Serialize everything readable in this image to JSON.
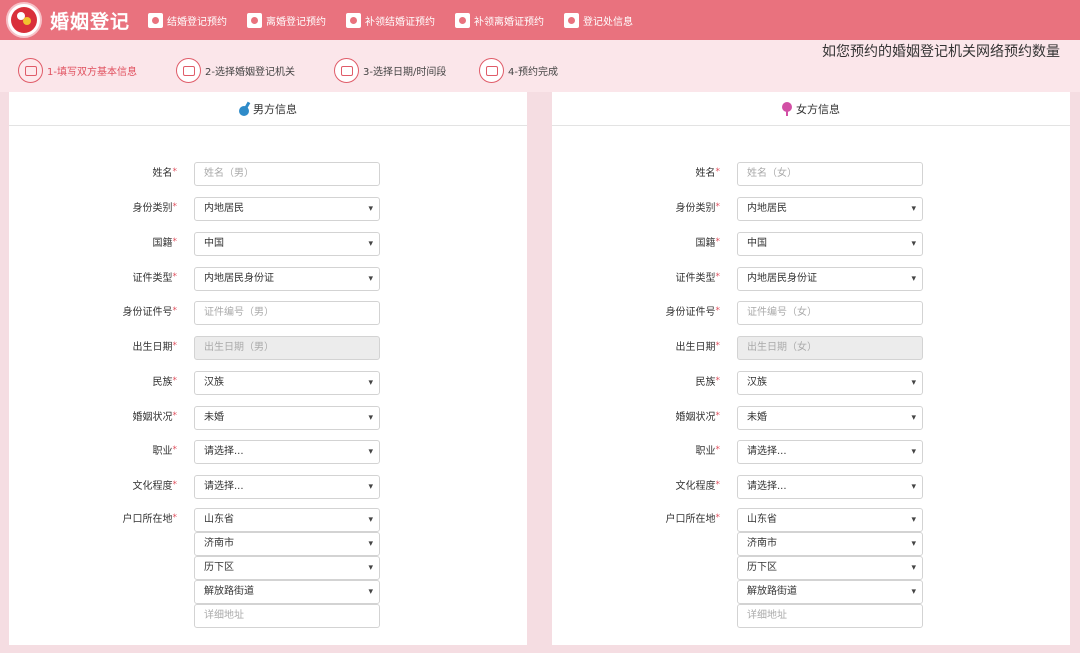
{
  "header": {
    "brand": "婚姻登记",
    "nav": [
      {
        "label": "结婚登记预约",
        "icon": "ring-certificate-icon"
      },
      {
        "label": "离婚登记预约",
        "icon": "certificate-icon"
      },
      {
        "label": "补领结婚证预约",
        "icon": "marriage-book-icon"
      },
      {
        "label": "补领离婚证预约",
        "icon": "divorce-book-icon"
      },
      {
        "label": "登记处信息",
        "icon": "office-icon"
      }
    ]
  },
  "notice": "如您预约的婚姻登记机关网络预约数量",
  "steps": [
    {
      "label": "1-填写双方基本信息",
      "icon": "id-card-icon"
    },
    {
      "label": "2-选择婚姻登记机关",
      "icon": "check-icon"
    },
    {
      "label": "3-选择日期/时间段",
      "icon": "calendar-check-icon"
    },
    {
      "label": "4-预约完成",
      "icon": "calendar-done-icon"
    }
  ],
  "colors": {
    "accent": "#e9727e",
    "required": "#e0505e"
  },
  "labels": {
    "name": "姓名",
    "id_category": "身份类别",
    "nationality": "国籍",
    "doc_type": "证件类型",
    "id_number": "身份证件号",
    "birth_date": "出生日期",
    "ethnicity": "民族",
    "marital_status": "婚姻状况",
    "occupation": "职业",
    "education": "文化程度",
    "household": "户口所在地"
  },
  "male": {
    "title": "男方信息",
    "name_placeholder": "姓名（男）",
    "id_category": "内地居民",
    "nationality": "中国",
    "doc_type": "内地居民身份证",
    "id_placeholder": "证件编号（男）",
    "birth_placeholder": "出生日期（男）",
    "ethnicity": "汉族",
    "marital_status": "未婚",
    "occupation": "请选择...",
    "education": "请选择...",
    "province": "山东省",
    "city": "济南市",
    "district": "历下区",
    "street": "解放路街道",
    "address_placeholder": "详细地址"
  },
  "female": {
    "title": "女方信息",
    "name_placeholder": "姓名（女）",
    "id_category": "内地居民",
    "nationality": "中国",
    "doc_type": "内地居民身份证",
    "id_placeholder": "证件编号（女）",
    "birth_placeholder": "出生日期（女）",
    "ethnicity": "汉族",
    "marital_status": "未婚",
    "occupation": "请选择...",
    "education": "请选择...",
    "province": "山东省",
    "city": "济南市",
    "district": "历下区",
    "street": "解放路街道",
    "address_placeholder": "详细地址"
  }
}
